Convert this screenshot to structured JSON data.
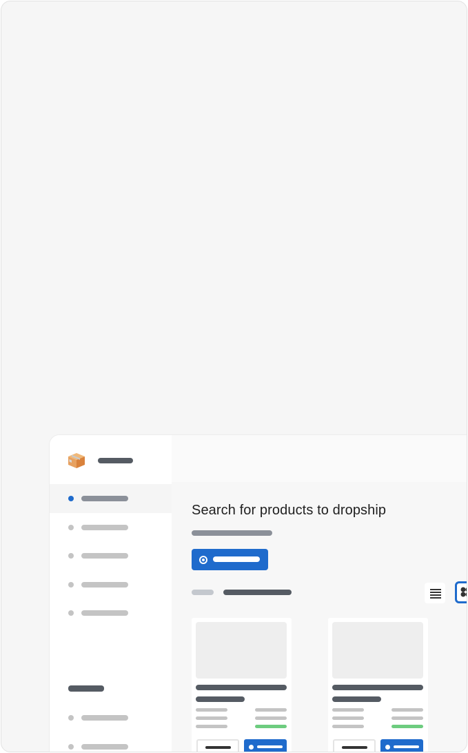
{
  "main": {
    "title": "Search for products to dropship"
  },
  "icons": {
    "brand": "package-box-icon",
    "list_view": "list-view-icon",
    "grid_view": "grid-view-icon",
    "primary_button": "radio-icon"
  },
  "colors": {
    "accent": "#1f6bcc",
    "success": "#6dcc7f",
    "frame_background": "#f6f6f6",
    "sidebar_background": "#ffffff"
  }
}
